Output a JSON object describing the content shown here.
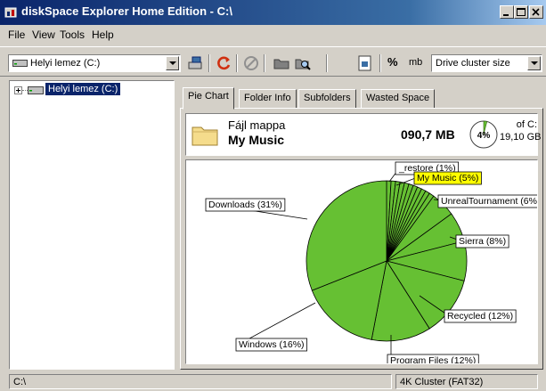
{
  "window": {
    "title": "diskSpace Explorer Home Edition - C:\\",
    "minimize_label": "minimize",
    "maximize_label": "maximize",
    "close_label": "close"
  },
  "menu": [
    "File",
    "View",
    "Tools",
    "Help"
  ],
  "toolbar": {
    "drive_selected": "Helyi lemez (C:)",
    "percent_label": "%",
    "mb_label": "mb",
    "cluster_selected": "Drive cluster size",
    "icons": [
      "drive-scan-icon",
      "refresh-icon",
      "stop-icon",
      "folder-icon",
      "search-folder-icon",
      "report-icon"
    ]
  },
  "tree": {
    "root_label": "Helyi lemez (C:)"
  },
  "tabs": [
    "Pie Chart",
    "Folder Info",
    "Subfolders",
    "Wasted Space"
  ],
  "folder_info": {
    "type": "Fájl mappa",
    "name": "My Music",
    "size": "090,7 MB",
    "percent": "4%",
    "percent_value": 4,
    "of_label": "of C:",
    "of_size": "19,10 GB"
  },
  "colors": {
    "pie_fill": "#66c033",
    "pie_stroke": "#000000",
    "highlight_label_bg": "#ffff00",
    "title_start": "#0a246a",
    "selection": "#0a246a"
  },
  "chart_data": {
    "type": "pie",
    "slices": [
      {
        "label": "_restore (1%)",
        "value": 1
      },
      {
        "label": "My Music (5%)",
        "value": 5,
        "highlighted": true
      },
      {
        "label": "UnrealTournament (6%)",
        "value": 6
      },
      {
        "label": "Sierra (8%)",
        "value": 8
      },
      {
        "label": "Recycled (12%)",
        "value": 12
      },
      {
        "label": "Program Files (12%)",
        "value": 12
      },
      {
        "label": "Windows (16%)",
        "value": 16
      },
      {
        "label": "Downloads (31%)",
        "value": 31
      }
    ]
  },
  "status": {
    "path": "C:\\",
    "cluster": "4K Cluster (FAT32)"
  }
}
